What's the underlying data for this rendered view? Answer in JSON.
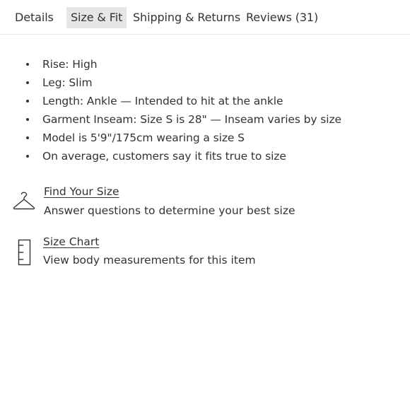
{
  "tabs": [
    {
      "label": "Details",
      "active": false
    },
    {
      "label": "Size & Fit",
      "active": true
    },
    {
      "label": "Shipping & Returns",
      "active": false
    },
    {
      "label": "Reviews (31)",
      "active": false
    }
  ],
  "fit_details": [
    "Rise: High",
    "Leg: Slim",
    "Length: Ankle — Intended to hit at the ankle",
    "Garment Inseam: Size S is 28\" — Inseam varies by size",
    "Model is 5'9\"/175cm wearing a size S",
    "On average, customers say it fits true to size"
  ],
  "find_your_size": {
    "icon": "hanger-icon",
    "link_label": "Find Your Size",
    "description": "Answer questions to determine your best size"
  },
  "size_chart": {
    "icon": "ruler-icon",
    "link_label": "Size Chart",
    "description": "View body measurements for this item"
  },
  "colors": {
    "text": "#333333",
    "active_tab_bg": "#e6e6e6",
    "divider": "#e6e6e6"
  }
}
